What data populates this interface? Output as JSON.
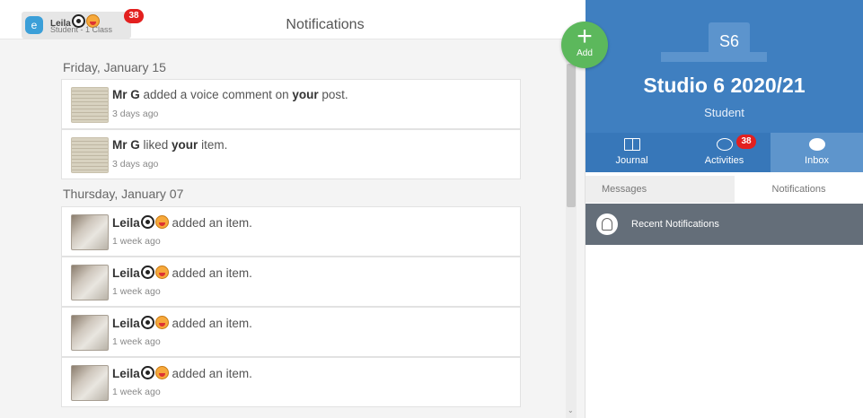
{
  "user": {
    "name": "Leila",
    "subtitle": "Student - 1 Class",
    "avatar_letter": "e",
    "notification_count": "38"
  },
  "header": {
    "title": "Notifications"
  },
  "groups": [
    {
      "date": "Friday, January 15",
      "items": [
        {
          "actor": "Mr G",
          "pre": " added a voice comment on ",
          "bold": "your",
          "post": " post.",
          "time": "3 days ago",
          "thumb": "worksheet"
        },
        {
          "actor": "Mr G",
          "pre": " liked ",
          "bold": "your",
          "post": " item.",
          "time": "3 days ago",
          "thumb": "worksheet"
        }
      ]
    },
    {
      "date": "Thursday, January 07",
      "items": [
        {
          "actor": "Leila",
          "text": " added an item.",
          "time": "1 week ago",
          "thumb": "photo"
        },
        {
          "actor": "Leila",
          "text": " added an item.",
          "time": "1 week ago",
          "thumb": "photo"
        },
        {
          "actor": "Leila",
          "text": " added an item.",
          "time": "1 week ago",
          "thumb": "photo"
        },
        {
          "actor": "Leila",
          "text": " added an item.",
          "time": "1 week ago",
          "thumb": "photo"
        }
      ]
    }
  ],
  "add_button": {
    "label": "Add",
    "icon": "plus-icon"
  },
  "class_panel": {
    "code": "S6",
    "title": "Studio 6 2020/21",
    "role": "Student",
    "tabs": [
      {
        "label": "Journal",
        "icon": "book-icon"
      },
      {
        "label": "Activities",
        "icon": "lightbulb-icon",
        "badge": "38"
      },
      {
        "label": "Inbox",
        "icon": "chat-bubble-icon"
      }
    ],
    "subtabs": [
      "Messages",
      "Notifications"
    ],
    "recent_label": "Recent Notifications"
  },
  "colors": {
    "header_blue": "#3f7fc0",
    "tab_blue": "#3777b9",
    "active_tab": "#5e95cc",
    "add_green": "#5cb85c",
    "badge_red": "#e3201f",
    "recent_bar": "#646e79"
  }
}
